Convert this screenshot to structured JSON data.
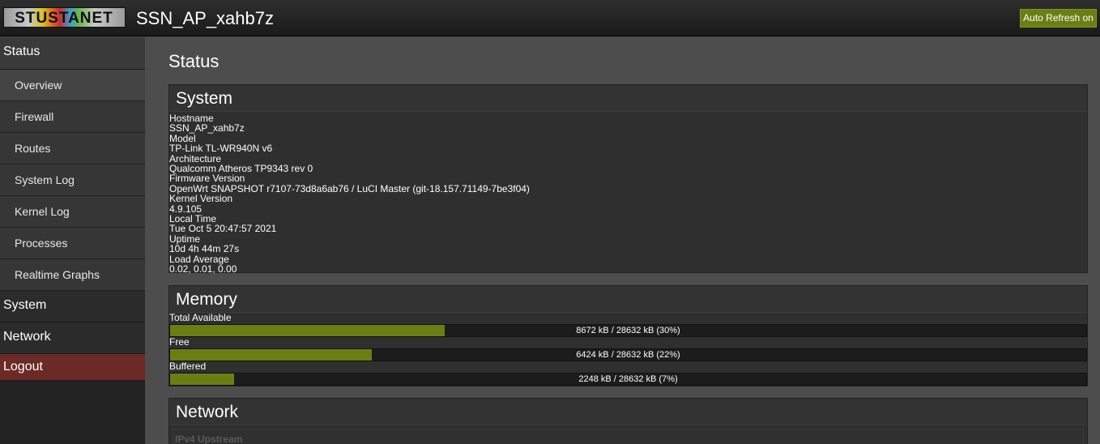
{
  "header": {
    "logo_text": "STUSTANET",
    "hostname_title": "SSN_AP_xahb7z",
    "auto_refresh_label": "Auto Refresh on"
  },
  "sidebar": {
    "status_label": "Status",
    "status_items": [
      {
        "label": "Overview"
      },
      {
        "label": "Firewall"
      },
      {
        "label": "Routes"
      },
      {
        "label": "System Log"
      },
      {
        "label": "Kernel Log"
      },
      {
        "label": "Processes"
      },
      {
        "label": "Realtime Graphs"
      }
    ],
    "system_label": "System",
    "network_label": "Network",
    "logout_label": "Logout"
  },
  "main": {
    "page_title": "Status",
    "system": {
      "title": "System",
      "rows": [
        {
          "key": "Hostname",
          "value": "SSN_AP_xahb7z"
        },
        {
          "key": "Model",
          "value": "TP-Link TL-WR940N v6"
        },
        {
          "key": "Architecture",
          "value": "Qualcomm Atheros TP9343 rev 0"
        },
        {
          "key": "Firmware Version",
          "value": "OpenWrt SNAPSHOT r7107-73d8a6ab76 / LuCI Master (git-18.157.71149-7be3f04)"
        },
        {
          "key": "Kernel Version",
          "value": "4.9.105"
        },
        {
          "key": "Local Time",
          "value": "Tue Oct 5 20:47:57 2021"
        },
        {
          "key": "Uptime",
          "value": "10d 4h 44m 27s"
        },
        {
          "key": "Load Average",
          "value": "0.02, 0.01, 0.00"
        }
      ]
    },
    "memory": {
      "title": "Memory",
      "bars": [
        {
          "label": "Total Available",
          "text": "8672 kB / 28632 kB (30%)",
          "fraction": 0.3
        },
        {
          "label": "Free",
          "text": "6424 kB / 28632 kB (22%)",
          "fraction": 0.22
        },
        {
          "label": "Buffered",
          "text": "2248 kB / 28632 kB (7%)",
          "fraction": 0.07
        }
      ]
    },
    "network": {
      "title": "Network",
      "subsection_label": "IPv4 Upstream"
    }
  },
  "colors": {
    "accent_green": "#6b7e14",
    "logout_red": "#6b2a26"
  }
}
